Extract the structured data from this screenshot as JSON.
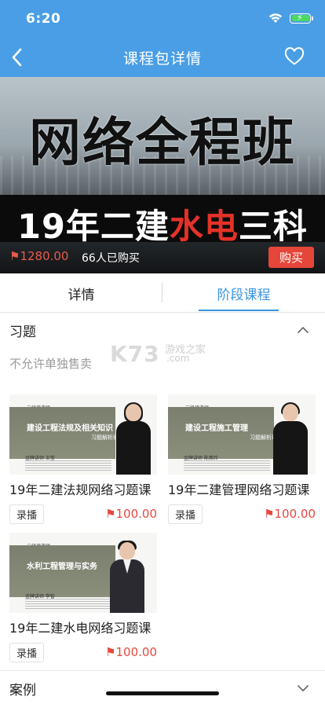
{
  "status_bar": {
    "time": "6:20"
  },
  "nav": {
    "title": "课程包详情"
  },
  "banner": {
    "headline": "网络全程班",
    "subtitle_prefix": "19年二建",
    "subtitle_highlight": "水电",
    "subtitle_suffix": "三科",
    "price": "⚑1280.00",
    "buyers": "66人已购买",
    "buy_label": "购买"
  },
  "tabs": [
    {
      "label": "详情"
    },
    {
      "label": "阶段课程"
    }
  ],
  "active_tab": "阶段课程",
  "sections": {
    "exercises": {
      "title": "习题",
      "notice": "不允许单独售卖"
    },
    "cases": {
      "title": "案例"
    }
  },
  "watermark": {
    "big": "K73",
    "small1": "游戏之家",
    "small2": ".com"
  },
  "courses": [
    {
      "title": "19年二建法规网络习题课",
      "badge": "录播",
      "price": "⚑100.00",
      "thumb_tag": "二级建造师",
      "thumb_title": "建设工程法规及相关知识",
      "thumb_sub": "习题解析班",
      "thumb_lecturer": "金牌讲师 王莹"
    },
    {
      "title": "19年二建管理网络习题课",
      "badge": "录播",
      "price": "⚑100.00",
      "thumb_tag": "二级建造师",
      "thumb_title": "建设工程施工管理",
      "thumb_sub": "习题解析班",
      "thumb_lecturer": "金牌讲师 陈燕玲"
    },
    {
      "title": "19年二建水电网络习题课",
      "badge": "录播",
      "price": "⚑100.00",
      "thumb_tag": "二级建造师",
      "thumb_title": "水利工程管理与实务",
      "thumb_sub": "",
      "thumb_lecturer": "金牌讲师 李智"
    }
  ],
  "colors": {
    "accent": "#3a93e0",
    "nav_bg": "#4a9ee6",
    "price": "#e64840",
    "buy_button": "#e4463a"
  }
}
